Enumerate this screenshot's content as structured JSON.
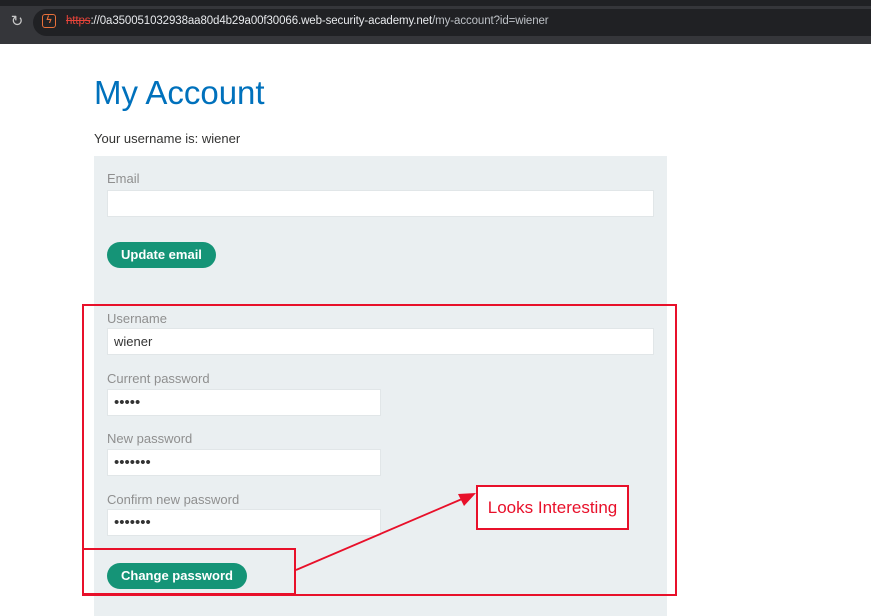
{
  "browser": {
    "url_protocol": "https",
    "url_host": "://0a350051032938aa80d4b29a00f30066.web-security-academy.net",
    "url_path": "/my-account?id=wiener"
  },
  "page": {
    "title": "My Account",
    "username_line": "Your username is: wiener"
  },
  "email_form": {
    "email_label": "Email",
    "email_value": "",
    "update_button": "Update email"
  },
  "password_form": {
    "username_label": "Username",
    "username_value": "wiener",
    "current_password_label": "Current password",
    "current_password_value": "•••••",
    "new_password_label": "New password",
    "new_password_value": "•••••••",
    "confirm_password_label": "Confirm new password",
    "confirm_password_value": "•••••••",
    "change_button": "Change password"
  },
  "annotation": {
    "note": "Looks Interesting",
    "color": "#e8102a"
  },
  "colors": {
    "title": "#0071bc",
    "button": "#159477",
    "panel": "#eaeff1"
  }
}
